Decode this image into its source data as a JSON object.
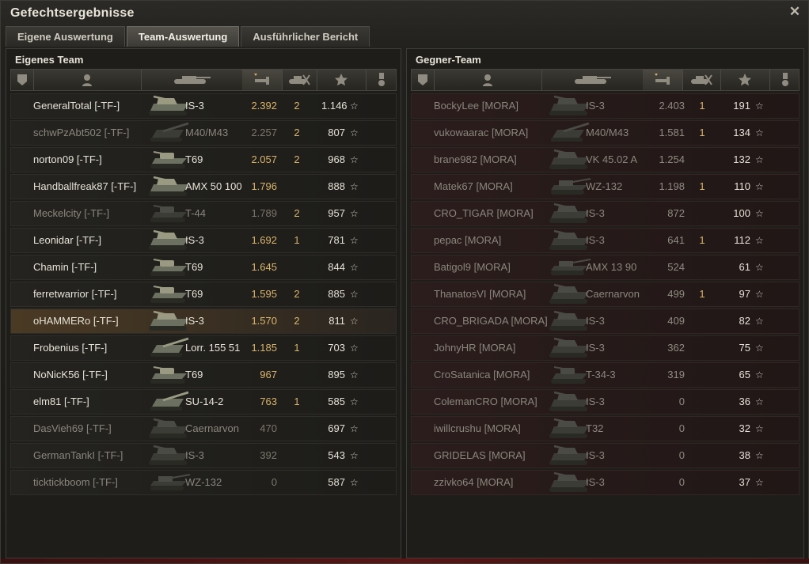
{
  "window": {
    "title": "Gefechtsergebnisse"
  },
  "tabs": [
    {
      "label": "Eigene Auswertung",
      "active": false
    },
    {
      "label": "Team-Auswertung",
      "active": true
    },
    {
      "label": "Ausführlicher Bericht",
      "active": false
    }
  ],
  "colors": {
    "accent": "#d9b46a",
    "enemy_row": "#2b1d1c",
    "ally_row": "#24231f"
  },
  "left": {
    "title": "Eigenes Team",
    "rows": [
      {
        "name": "GeneralTotal [-TF-]",
        "tank": "IS-3",
        "damage": "2.392",
        "kills": "2",
        "xp": "1.146",
        "dead": false,
        "self": false,
        "icon": "heavy-tank-icon"
      },
      {
        "name": "schwPzAbt502 [-TF-]",
        "tank": "M40/M43",
        "damage": "2.257",
        "kills": "2",
        "xp": "807",
        "dead": true,
        "self": false,
        "icon": "spg-icon"
      },
      {
        "name": "norton09 [-TF-]",
        "tank": "T69",
        "damage": "2.057",
        "kills": "2",
        "xp": "968",
        "dead": false,
        "self": false,
        "icon": "medium-tank-icon"
      },
      {
        "name": "Handballfreak87 [-TF-]",
        "tank": "AMX 50 100",
        "damage": "1.796",
        "kills": "",
        "xp": "888",
        "dead": false,
        "self": false,
        "icon": "heavy-tank-icon"
      },
      {
        "name": "Meckelcity [-TF-]",
        "tank": "T-44",
        "damage": "1.789",
        "kills": "2",
        "xp": "957",
        "dead": true,
        "self": false,
        "icon": "medium-tank-icon"
      },
      {
        "name": "Leonidar [-TF-]",
        "tank": "IS-3",
        "damage": "1.692",
        "kills": "1",
        "xp": "781",
        "dead": false,
        "self": false,
        "icon": "heavy-tank-icon"
      },
      {
        "name": "Chamin [-TF-]",
        "tank": "T69",
        "damage": "1.645",
        "kills": "",
        "xp": "844",
        "dead": false,
        "self": false,
        "icon": "medium-tank-icon"
      },
      {
        "name": "ferretwarrior [-TF-]",
        "tank": "T69",
        "damage": "1.595",
        "kills": "2",
        "xp": "885",
        "dead": false,
        "self": false,
        "icon": "medium-tank-icon"
      },
      {
        "name": "oHAMMERo [-TF-]",
        "tank": "IS-3",
        "damage": "1.570",
        "kills": "2",
        "xp": "811",
        "dead": false,
        "self": true,
        "icon": "heavy-tank-icon"
      },
      {
        "name": "Frobenius [-TF-]",
        "tank": "Lorr. 155 51",
        "damage": "1.185",
        "kills": "1",
        "xp": "703",
        "dead": false,
        "self": false,
        "icon": "spg-icon"
      },
      {
        "name": "NoNicK56 [-TF-]",
        "tank": "T69",
        "damage": "967",
        "kills": "",
        "xp": "895",
        "dead": false,
        "self": false,
        "icon": "medium-tank-icon"
      },
      {
        "name": "elm81 [-TF-]",
        "tank": "SU-14-2",
        "damage": "763",
        "kills": "1",
        "xp": "585",
        "dead": false,
        "self": false,
        "icon": "spg-icon"
      },
      {
        "name": "DasVieh69 [-TF-]",
        "tank": "Caernarvon",
        "damage": "470",
        "kills": "",
        "xp": "697",
        "dead": true,
        "self": false,
        "icon": "heavy-tank-icon"
      },
      {
        "name": "GermanTankI [-TF-]",
        "tank": "IS-3",
        "damage": "392",
        "kills": "",
        "xp": "543",
        "dead": true,
        "self": false,
        "icon": "heavy-tank-icon"
      },
      {
        "name": "ticktickboom [-TF-]",
        "tank": "WZ-132",
        "damage": "0",
        "kills": "",
        "xp": "587",
        "dead": true,
        "self": false,
        "icon": "light-tank-icon"
      }
    ]
  },
  "right": {
    "title": "Gegner-Team",
    "rows": [
      {
        "name": "BockyLee [MORA]",
        "tank": "IS-3",
        "damage": "2.403",
        "kills": "1",
        "xp": "191",
        "dead": true,
        "icon": "heavy-tank-icon"
      },
      {
        "name": "vukowaarac [MORA]",
        "tank": "M40/M43",
        "damage": "1.581",
        "kills": "1",
        "xp": "134",
        "dead": true,
        "icon": "spg-icon"
      },
      {
        "name": "brane982 [MORA]",
        "tank": "VK 45.02 A",
        "damage": "1.254",
        "kills": "",
        "xp": "132",
        "dead": true,
        "icon": "heavy-tank-icon"
      },
      {
        "name": "Matek67 [MORA]",
        "tank": "WZ-132",
        "damage": "1.198",
        "kills": "1",
        "xp": "110",
        "dead": true,
        "icon": "light-tank-icon"
      },
      {
        "name": "CRO_TIGAR [MORA]",
        "tank": "IS-3",
        "damage": "872",
        "kills": "",
        "xp": "100",
        "dead": true,
        "icon": "heavy-tank-icon"
      },
      {
        "name": "pepac [MORA]",
        "tank": "IS-3",
        "damage": "641",
        "kills": "1",
        "xp": "112",
        "dead": true,
        "icon": "heavy-tank-icon"
      },
      {
        "name": "Batigol9 [MORA]",
        "tank": "AMX 13 90",
        "damage": "524",
        "kills": "",
        "xp": "61",
        "dead": true,
        "icon": "light-tank-icon"
      },
      {
        "name": "ThanatosVI [MORA]",
        "tank": "Caernarvon",
        "damage": "499",
        "kills": "1",
        "xp": "97",
        "dead": true,
        "icon": "heavy-tank-icon"
      },
      {
        "name": "CRO_BRIGADA [MORA]",
        "tank": "IS-3",
        "damage": "409",
        "kills": "",
        "xp": "82",
        "dead": true,
        "icon": "heavy-tank-icon"
      },
      {
        "name": "JohnyHR [MORA]",
        "tank": "IS-3",
        "damage": "362",
        "kills": "",
        "xp": "75",
        "dead": true,
        "icon": "heavy-tank-icon"
      },
      {
        "name": "CroSatanica [MORA]",
        "tank": "T-34-3",
        "damage": "319",
        "kills": "",
        "xp": "65",
        "dead": true,
        "icon": "medium-tank-icon"
      },
      {
        "name": "ColemanCRO [MORA]",
        "tank": "IS-3",
        "damage": "0",
        "kills": "",
        "xp": "36",
        "dead": true,
        "icon": "heavy-tank-icon"
      },
      {
        "name": "iwillcrushu [MORA]",
        "tank": "T32",
        "damage": "0",
        "kills": "",
        "xp": "32",
        "dead": true,
        "icon": "heavy-tank-icon"
      },
      {
        "name": "GRIDELAS [MORA]",
        "tank": "IS-3",
        "damage": "0",
        "kills": "",
        "xp": "38",
        "dead": true,
        "icon": "heavy-tank-icon"
      },
      {
        "name": "zzivko64 [MORA]",
        "tank": "IS-3",
        "damage": "0",
        "kills": "",
        "xp": "37",
        "dead": true,
        "icon": "heavy-tank-icon"
      }
    ]
  },
  "columns": [
    {
      "icon": "squad-icon"
    },
    {
      "icon": "player-icon"
    },
    {
      "icon": "tank-icon"
    },
    {
      "icon": "damage-icon"
    },
    {
      "icon": "kills-icon"
    },
    {
      "icon": "xp-star-icon"
    },
    {
      "icon": "medal-icon"
    }
  ]
}
